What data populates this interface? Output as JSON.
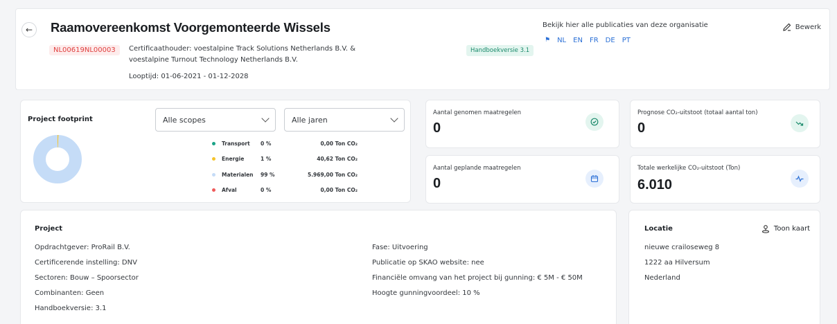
{
  "header": {
    "title": "Raamovereenkomst Voorgemonteerde Wissels",
    "project_id": "NL00619NL00003",
    "holder_line1": "Certificaathouder: voestalpine Track Solutions Netherlands B.V. &",
    "holder_line2": "voestalpine Turnout Technology Netherlands B.V.",
    "looptijd": "Looptijd: 01-06-2021 - 01-12-2028",
    "handboek_badge": "Handboekversie 3.1",
    "publications_text": "Bekijk hier alle publicaties van deze organisatie",
    "languages": [
      "NL",
      "EN",
      "FR",
      "DE",
      "PT"
    ],
    "edit_label": "Bewerk"
  },
  "footprint": {
    "title": "Project footprint",
    "scope_select": "Alle scopes",
    "years_select": "Alle jaren",
    "legend": [
      {
        "name": "Transport",
        "pct": "0 %",
        "value": "0,00 Ton CO₂",
        "color": "#1aa387"
      },
      {
        "name": "Energie",
        "pct": "1 %",
        "value": "40,62 Ton CO₂",
        "color": "#f5c42c"
      },
      {
        "name": "Materialen",
        "pct": "99 %",
        "value": "5.969,00 Ton CO₂",
        "color": "#c5dcf7"
      },
      {
        "name": "Afval",
        "pct": "0 %",
        "value": "0,00 Ton CO₂",
        "color": "#ef5b5b"
      }
    ],
    "donut_fractions": [
      0.0,
      0.0068,
      0.9932,
      0.0
    ]
  },
  "stats": {
    "measures_taken_title": "Aantal genomen maatregelen",
    "measures_taken_value": "0",
    "measures_planned_title": "Aantal geplande maatregelen",
    "measures_planned_value": "0",
    "forecast_title": "Prognose CO₂-uitstoot (totaal aantal ton)",
    "forecast_value": "0",
    "actual_title": "Totale werkelijke CO₂-uitstoot (Ton)",
    "actual_value": "6.010"
  },
  "project": {
    "title": "Project",
    "left": [
      "Opdrachtgever: ProRail B.V.",
      "Certificerende instelling: DNV",
      "Sectoren: Bouw – Spoorsector",
      "Combinanten: Geen",
      "Handboekversie: 3.1"
    ],
    "right": [
      "Fase: Uitvoering",
      "Publicatie op SKAO website: nee",
      "Financiële omvang van het project bij gunning: € 5M - € 50M",
      "Hoogte gunningvoordeel: 10 %"
    ]
  },
  "location": {
    "title": "Locatie",
    "map_button": "Toon kaart",
    "lines": [
      "nieuwe crailoseweg 8",
      "1222 aa Hilversum",
      "Nederland"
    ]
  }
}
